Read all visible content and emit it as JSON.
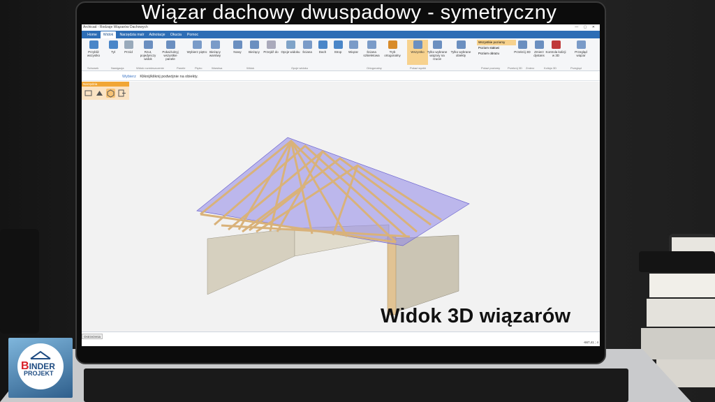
{
  "headline": "Wiązar dachowy dwuspadowy - symetryczny",
  "caption": "Widok 3D wiązarów",
  "app": {
    "title": "Archicad - Rodzaje Wiązarów Dachowych",
    "tabs": [
      "Home",
      "Widok",
      "Narzędzia malr",
      "Adnotacje",
      "Okucia",
      "Pomoc"
    ],
    "active_tab": "Widok"
  },
  "ribbon": {
    "buttons": [
      {
        "label": "Przybliż wszystko",
        "icon": "zoom-all-icon"
      },
      {
        "label": "Tył",
        "icon": "back-arrow-icon"
      },
      {
        "label": "Przód",
        "icon": "forward-arrow-icon"
      },
      {
        "label": "Rzut, pojedynczy widok",
        "icon": "single-view-icon"
      },
      {
        "label": "Pokaż/ukryj wszystkie panele",
        "icon": "panels-icon"
      },
      {
        "label": "Wybierz piętro",
        "icon": "floor-icon"
      },
      {
        "label": "Bieżący warstwy",
        "icon": "layers-icon"
      },
      {
        "label": "Nowy",
        "icon": "new-icon"
      },
      {
        "label": "Bieżący",
        "icon": "current-icon"
      },
      {
        "label": "Przejdź do",
        "icon": "goto-icon"
      },
      {
        "label": "Opcje widoku",
        "icon": "eye-icon"
      },
      {
        "label": "Ściana",
        "icon": "wall-icon"
      },
      {
        "label": "Dach",
        "icon": "roof-icon"
      },
      {
        "label": "Strop",
        "icon": "slab-icon"
      },
      {
        "label": "Wiązar",
        "icon": "truss-icon"
      },
      {
        "label": "Ściana szkieletowa",
        "icon": "frame-wall-icon"
      },
      {
        "label": "Tryb ortogonalny",
        "icon": "ortho-icon"
      },
      {
        "label": "Wszystko",
        "icon": "eye-all-icon"
      },
      {
        "label": "Tylko wybrane wiązary na rzucie",
        "icon": "eye-selected-icon"
      },
      {
        "label": "Tylko wybrane obiekty",
        "icon": "eye-objects-icon"
      },
      {
        "label": "Przekrój 3D",
        "icon": "section-3d-icon"
      },
      {
        "label": "Zmierz dystans",
        "icon": "measure-icon"
      },
      {
        "label": "Kontrola kolizji w 3D",
        "icon": "collision-icon"
      },
      {
        "label": "Przegląd wiązar",
        "icon": "review-icon"
      }
    ],
    "level_options": [
      "Wszystkie poziomy",
      "Poziom stałowi",
      "Poziom obrazu"
    ],
    "groups": [
      "Schowek",
      "Nawigacja",
      "Widok rozmieszczenie",
      "Panele",
      "Piętro",
      "Warstwa",
      "Widok",
      "Opcje widoku",
      "Ortogonalny",
      "Pokaż wyniki",
      "Pokaż poziomy",
      "Przekrój 3D",
      "Zmierz",
      "Kolizja 3D",
      "Przegląd"
    ]
  },
  "command": {
    "keyword": "Wybierz",
    "text": "Kliknij/kliknij podwójnie na obiekty."
  },
  "mini_toolbar": {
    "title": "Narzędzia",
    "active_index": 2
  },
  "status": {
    "tab": "Ostrzeżenia",
    "coords": "-667,41 ; 4"
  },
  "logo": {
    "line1": "BINDER",
    "line2": "PROJEKT"
  },
  "colors": {
    "ribbon_blue": "#2d6db5",
    "highlight": "#f7d28e",
    "roof_plane": "#8f87e8",
    "timber": "#d9b27a"
  }
}
